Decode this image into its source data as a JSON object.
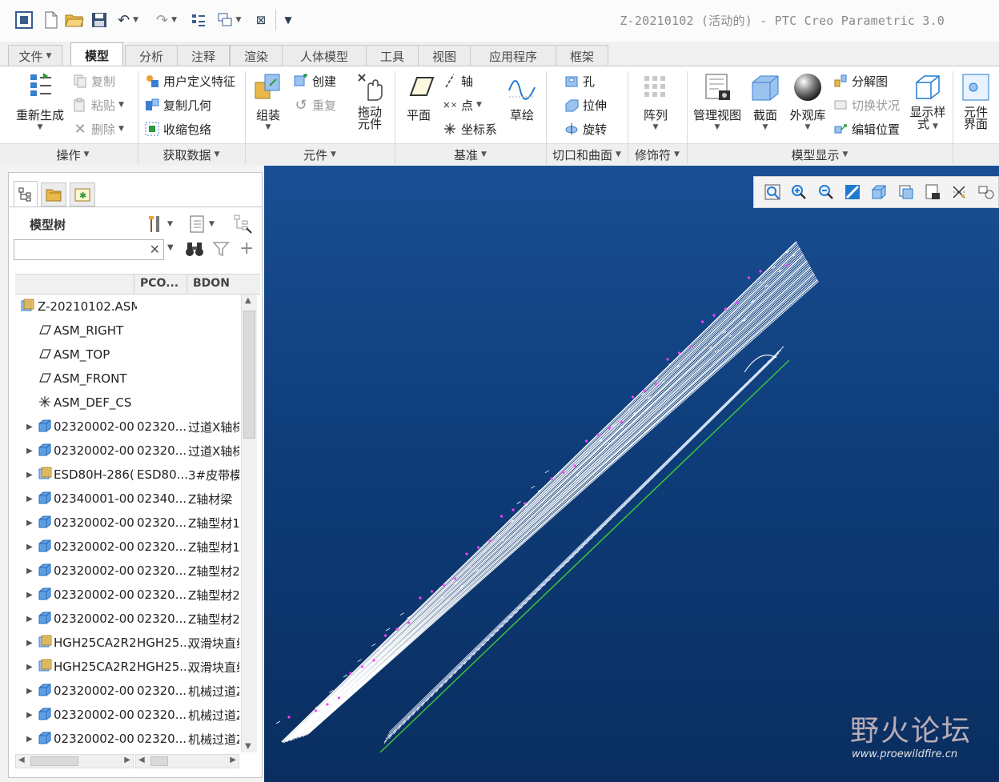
{
  "window": {
    "title": "Z-20210102 (活动的) - PTC Creo Parametric 3.0"
  },
  "tabs": [
    {
      "label": "文件",
      "has_caret": true
    },
    {
      "label": "模型",
      "active": true
    },
    {
      "label": "分析"
    },
    {
      "label": "注释"
    },
    {
      "label": "渲染"
    },
    {
      "label": "人体模型"
    },
    {
      "label": "工具"
    },
    {
      "label": "视图"
    },
    {
      "label": "应用程序"
    },
    {
      "label": "框架"
    }
  ],
  "ribbon": {
    "regenerate": "重新生成",
    "copy": "复制",
    "paste": "粘贴",
    "delete": "删除",
    "udf": "用户定义特征",
    "copy_geom": "复制几何",
    "shrinkwrap": "收缩包络",
    "assemble": "组装",
    "create": "创建",
    "repeat": "重复",
    "drag_line1": "拖动",
    "drag_line2": "元件",
    "plane": "平面",
    "axis": "轴",
    "point": "点",
    "csys": "坐标系",
    "sketch": "草绘",
    "hole": "孔",
    "extrude": "拉伸",
    "revolve": "旋转",
    "pattern": "阵列",
    "manage_views": "管理视图",
    "section": "截面",
    "appearance": "外观库",
    "explode": "分解图",
    "toggle_status": "切换状况",
    "edit_position": "编辑位置",
    "display_style_line1": "显示样",
    "display_style_line2": "式",
    "comp_interface_line1": "元件",
    "comp_interface_line2": "界面"
  },
  "groups": {
    "operations": "操作",
    "get_data": "获取数据",
    "component": "元件",
    "datum": "基准",
    "cut_surface": "切口和曲面",
    "modifier": "修饰符",
    "model_display": "模型显示"
  },
  "model_tree": {
    "title": "模型树",
    "search_placeholder": "",
    "columns": [
      "",
      "PCO...",
      "BDON"
    ],
    "rows": [
      {
        "name": "Z-20210102.ASM",
        "c2": "",
        "c3": "",
        "icon": "assembly",
        "expander": false,
        "indent": 0
      },
      {
        "name": "ASM_RIGHT",
        "c2": "",
        "c3": "",
        "icon": "plane",
        "expander": false,
        "indent": 1
      },
      {
        "name": "ASM_TOP",
        "c2": "",
        "c3": "",
        "icon": "plane",
        "expander": false,
        "indent": 1
      },
      {
        "name": "ASM_FRONT",
        "c2": "",
        "c3": "",
        "icon": "plane",
        "expander": false,
        "indent": 1
      },
      {
        "name": "ASM_DEF_CS",
        "c2": "",
        "c3": "",
        "icon": "csys",
        "expander": false,
        "indent": 1
      },
      {
        "name": "02320002-00",
        "c2": "02320...",
        "c3": "过道X轴梯",
        "icon": "part",
        "expander": true,
        "indent": 1
      },
      {
        "name": "02320002-00",
        "c2": "02320...",
        "c3": "过道X轴梯",
        "icon": "part",
        "expander": true,
        "indent": 1
      },
      {
        "name": "ESD80H-286(",
        "c2": "ESD80...",
        "c3": "3#皮带模",
        "icon": "assembly",
        "expander": true,
        "indent": 1
      },
      {
        "name": "02340001-00",
        "c2": "02340...",
        "c3": "Z轴材梁",
        "icon": "part",
        "expander": true,
        "indent": 1
      },
      {
        "name": "02320002-00",
        "c2": "02320...",
        "c3": "Z轴型材1",
        "icon": "part",
        "expander": true,
        "indent": 1
      },
      {
        "name": "02320002-00",
        "c2": "02320...",
        "c3": "Z轴型材1",
        "icon": "part",
        "expander": true,
        "indent": 1
      },
      {
        "name": "02320002-00",
        "c2": "02320...",
        "c3": "Z轴型材2",
        "icon": "part",
        "expander": true,
        "indent": 1
      },
      {
        "name": "02320002-00",
        "c2": "02320...",
        "c3": "Z轴型材2",
        "icon": "part",
        "expander": true,
        "indent": 1
      },
      {
        "name": "02320002-00",
        "c2": "02320...",
        "c3": "Z轴型材2",
        "icon": "part",
        "expander": true,
        "indent": 1
      },
      {
        "name": "HGH25CA2R2",
        "c2": "HGH25...",
        "c3": "双滑块直线",
        "icon": "assembly",
        "expander": true,
        "indent": 1
      },
      {
        "name": "HGH25CA2R2",
        "c2": "HGH25...",
        "c3": "双滑块直线",
        "icon": "assembly",
        "expander": true,
        "indent": 1
      },
      {
        "name": "02320002-00",
        "c2": "02320...",
        "c3": "机械过道Z",
        "icon": "part",
        "expander": true,
        "indent": 1
      },
      {
        "name": "02320002-00",
        "c2": "02320...",
        "c3": "机械过道Z",
        "icon": "part",
        "expander": true,
        "indent": 1
      },
      {
        "name": "02320002-00",
        "c2": "02320...",
        "c3": "机械过道Z",
        "icon": "part",
        "expander": true,
        "indent": 1
      }
    ]
  },
  "watermark": {
    "brand": "野火论坛",
    "url": "www.proewildfire.cn"
  },
  "colors": {
    "viewport_top": "#1a4f94",
    "viewport_bottom": "#0a2e60",
    "accent": "#1f7bd1"
  }
}
